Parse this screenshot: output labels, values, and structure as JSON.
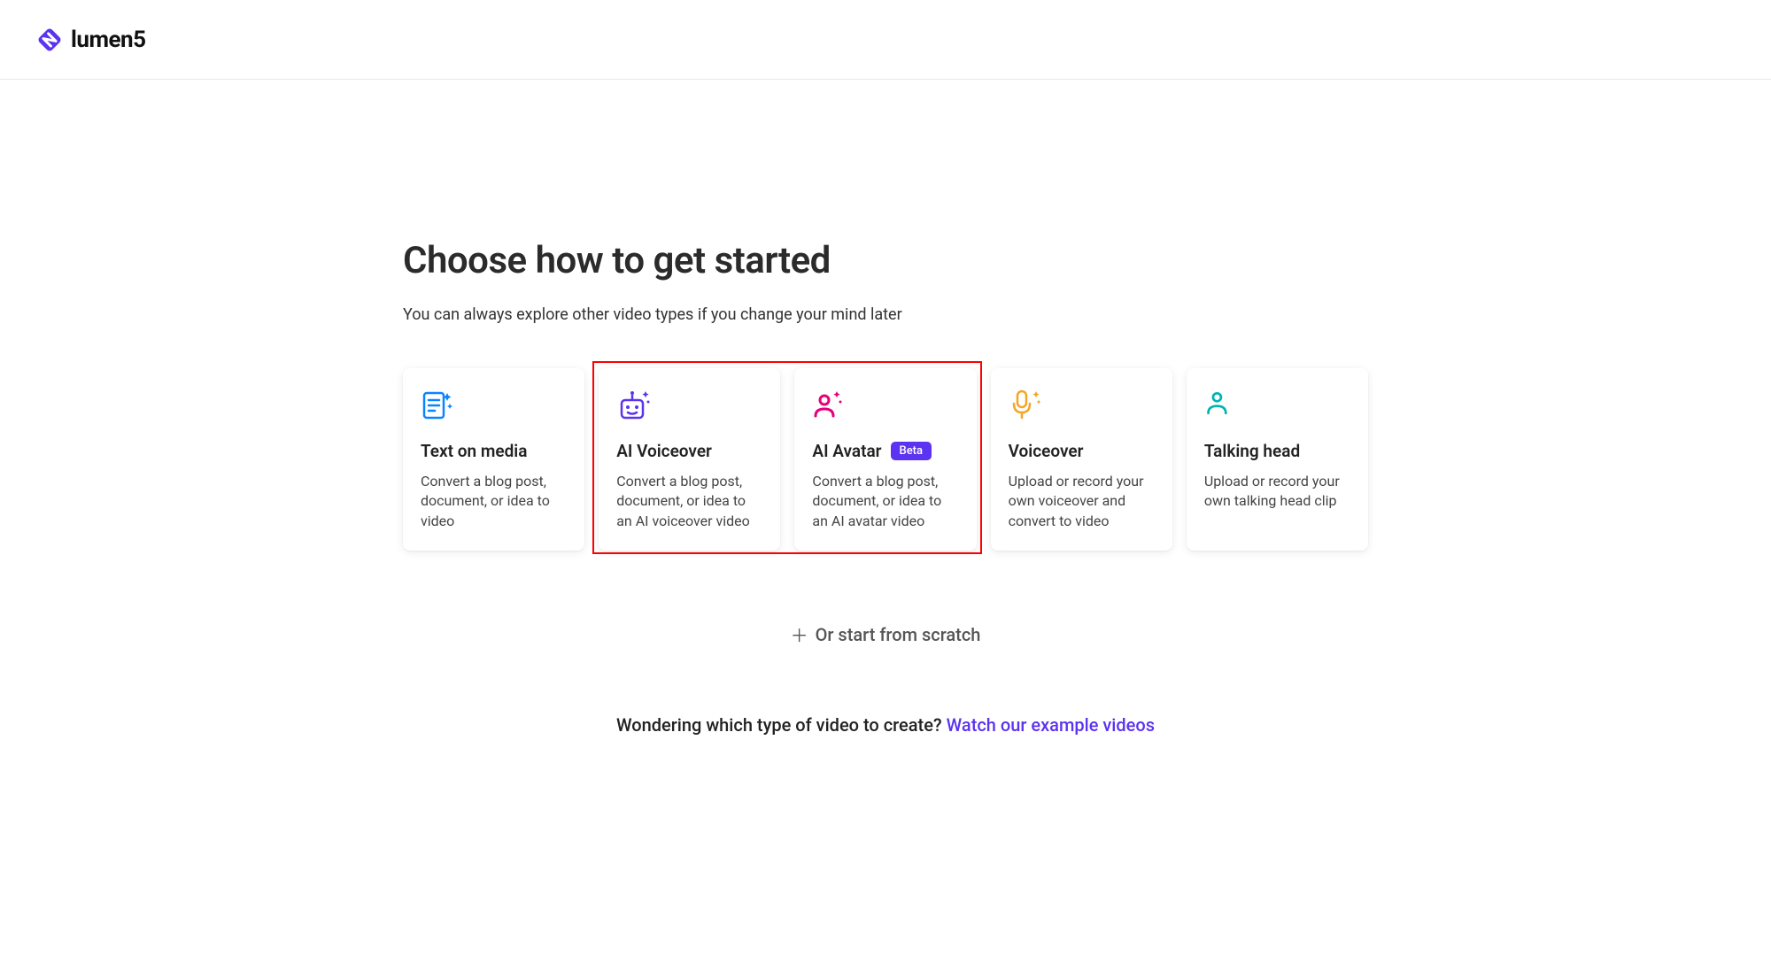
{
  "brand": {
    "name": "lumen5"
  },
  "header": {
    "title": "Choose how to get started",
    "subtitle": "You can always explore other video types if you change your mind later"
  },
  "cards": [
    {
      "id": "text-on-media",
      "title": "Text on media",
      "desc": "Convert a blog post, document, or idea to video",
      "badge": null
    },
    {
      "id": "ai-voiceover",
      "title": "AI Voiceover",
      "desc": "Convert a blog post, document, or idea to an AI voiceover video",
      "badge": null
    },
    {
      "id": "ai-avatar",
      "title": "AI Avatar",
      "desc": "Convert a blog post, document, or idea to an AI avatar video",
      "badge": "Beta"
    },
    {
      "id": "voiceover",
      "title": "Voiceover",
      "desc": "Upload or record your own voiceover and convert to video",
      "badge": null
    },
    {
      "id": "talking-head",
      "title": "Talking head",
      "desc": "Upload or record your own talking head clip",
      "badge": null
    }
  ],
  "scratch": {
    "label": "Or start from scratch"
  },
  "help": {
    "prompt": "Wondering which type of video to create? ",
    "link_text": "Watch our example videos"
  },
  "highlight": {
    "card_ids": [
      "ai-voiceover",
      "ai-avatar"
    ]
  }
}
